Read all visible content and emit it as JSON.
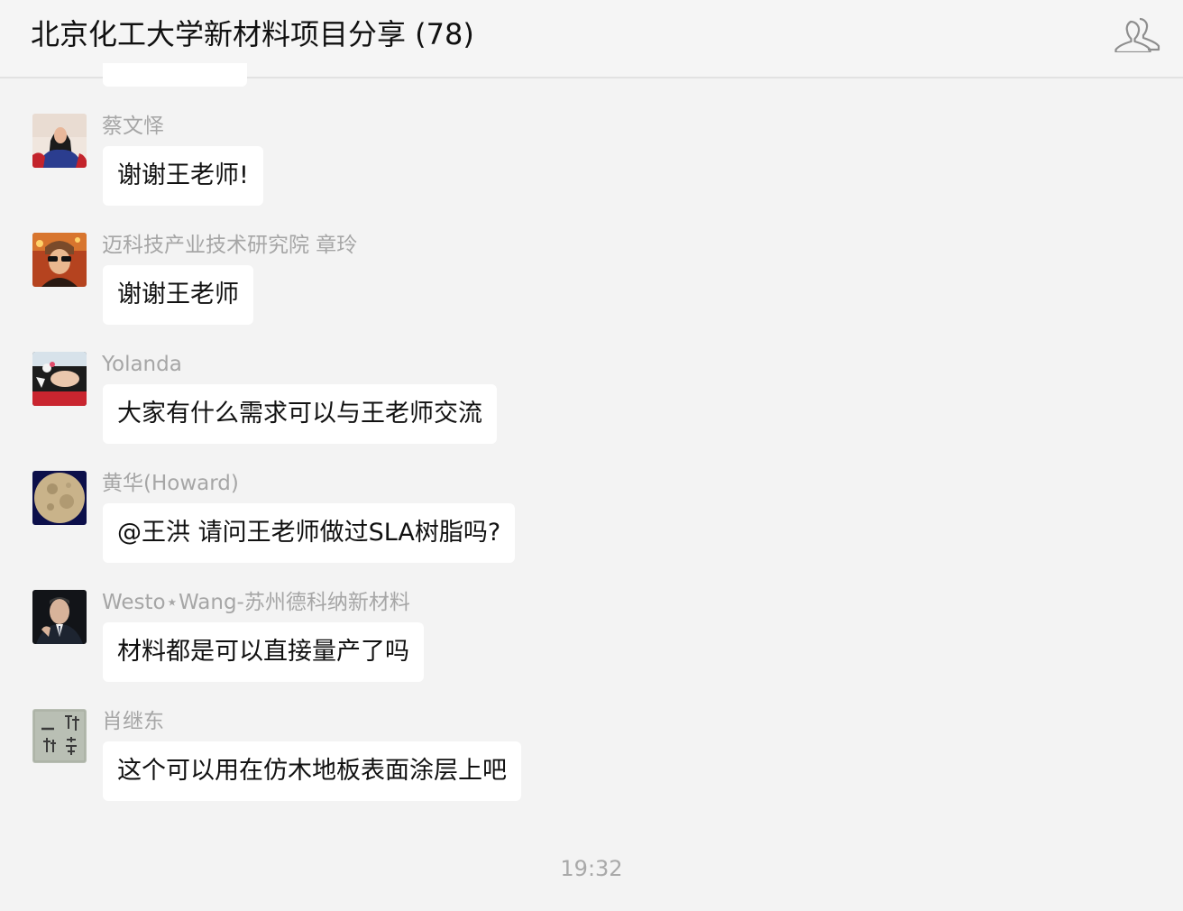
{
  "header": {
    "title": "北京化工大学新材料项目分享 (78)",
    "members_icon": "group-members-icon"
  },
  "messages": [
    {
      "sender": "蔡文怿",
      "text": "谢谢王老师!",
      "avatar": "avatar-woman-graduation-gown"
    },
    {
      "sender": "迈科技产业技术研究院 章玲",
      "text": "谢谢王老师",
      "avatar": "avatar-person-sunglasses"
    },
    {
      "sender": "Yolanda",
      "text": "大家有什么需求可以与王老师交流",
      "avatar": "avatar-woman-lying-flowers"
    },
    {
      "sender": "黄华(Howard)",
      "text": "@王洪 请问王老师做过SLA树脂吗?",
      "avatar": "avatar-full-moon"
    },
    {
      "sender": "Westo⋆Wang-苏州德科纳新材料",
      "text": "材料都是可以直接量产了吗",
      "avatar": "avatar-man-suit"
    },
    {
      "sender": "肖继东",
      "text": "这个可以用在仿木地板表面涂层上吧",
      "avatar": "avatar-calligraphy-tea"
    }
  ],
  "timestamp": "19:32",
  "colors": {
    "background": "#f3f3f3",
    "bubble": "#ffffff",
    "sender_name": "#a6a6a6",
    "timestamp": "#a9a9a9"
  }
}
